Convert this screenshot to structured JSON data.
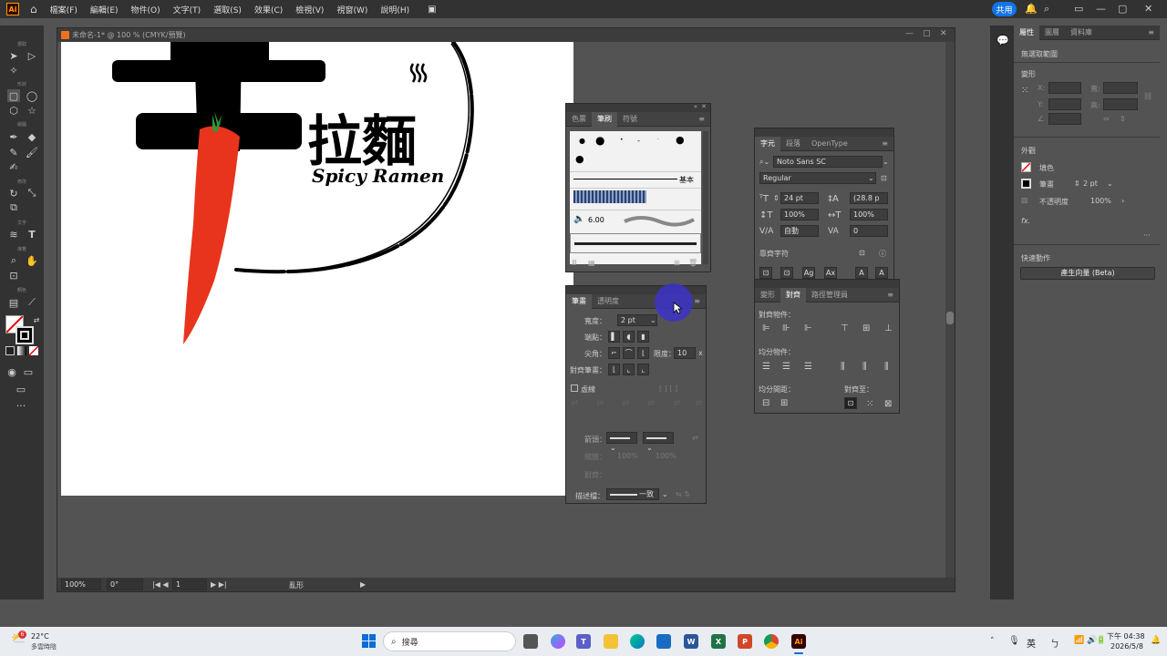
{
  "app": {
    "logo": "Ai",
    "menu": [
      "檔案(F)",
      "編輯(E)",
      "物件(O)",
      "文字(T)",
      "選取(S)",
      "效果(C)",
      "檢視(V)",
      "視窗(W)",
      "說明(H)"
    ],
    "share_label": "共用"
  },
  "toolbar": {
    "groups": [
      "選取",
      "形狀",
      "繪圖",
      "修改",
      "文字",
      "導覽",
      "顏色"
    ]
  },
  "document": {
    "tab_title": "未命名-1* @ 100 % (CMYK/預覽)",
    "status": {
      "zoom": "100%",
      "rotation": "0°",
      "artboard_num": "1",
      "tool_name": "亂形"
    },
    "artwork": {
      "title_cn": "拉麵",
      "subtitle_en": "Spicy Ramen"
    }
  },
  "brushes_panel": {
    "tabs": [
      "色票",
      "筆刷",
      "符號"
    ],
    "active_tab": "筆刷",
    "basic_label": "基本",
    "size_value": "6.00"
  },
  "stroke_panel": {
    "tabs": [
      "筆畫",
      "透明度"
    ],
    "active_tab": "筆畫",
    "weight_label": "寬度：",
    "weight_value": "2 pt",
    "cap_label": "端點：",
    "corner_label": "尖角：",
    "limit_label": "限度：",
    "limit_value": "10",
    "align_label": "對齊筆畫：",
    "dashed_label": "虛線",
    "arrow_label": "箭頭：",
    "scale_label": "縮放：",
    "scale_a": "100%",
    "scale_b": "100%",
    "align2_label": "對齊：",
    "profile_label": "描述檔：",
    "profile_value": "一致"
  },
  "character_panel": {
    "tabs": [
      "字元",
      "段落",
      "OpenType"
    ],
    "active_tab": "字元",
    "font_family": "Noto Sans SC",
    "font_style": "Regular",
    "size": "24 pt",
    "leading": "(28.8 p",
    "vscale": "100%",
    "hscale": "100%",
    "kerning": "自動",
    "tracking": "0",
    "snap_label": "靠齊字符"
  },
  "align_panel": {
    "tabs": [
      "變形",
      "對齊",
      "路徑管理員"
    ],
    "active_tab": "對齊",
    "align_objects_label": "對齊物件：",
    "distribute_objects_label": "均分物件：",
    "distribute_spacing_label": "均分間距：",
    "align_to_label": "對齊至："
  },
  "properties_panel": {
    "tabs": [
      "屬性",
      "圖層",
      "資料庫"
    ],
    "active_tab": "屬性",
    "no_selection": "無選取範圍",
    "transform_label": "變形",
    "x_label": "X:",
    "y_label": "Y:",
    "w_label": "寬:",
    "h_label": "高:",
    "appearance_label": "外觀",
    "fill_label": "填色",
    "stroke_label": "筆畫",
    "stroke_value": "2 pt",
    "opacity_label": "不透明度",
    "opacity_value": "100%",
    "fx_label": "fx.",
    "quick_actions_label": "快速動作",
    "vector_button": "產生向量 (Beta)"
  },
  "taskbar": {
    "weather_temp": "22°C",
    "weather_desc": "多雲時陰",
    "search_placeholder": "搜尋",
    "ime": "英",
    "time": "下午 04:38",
    "date": "2026/5/8"
  },
  "colors": {
    "accent": "#1473e6",
    "carrot": "#e8341c",
    "carrot_leaf": "#2e9a3a"
  }
}
